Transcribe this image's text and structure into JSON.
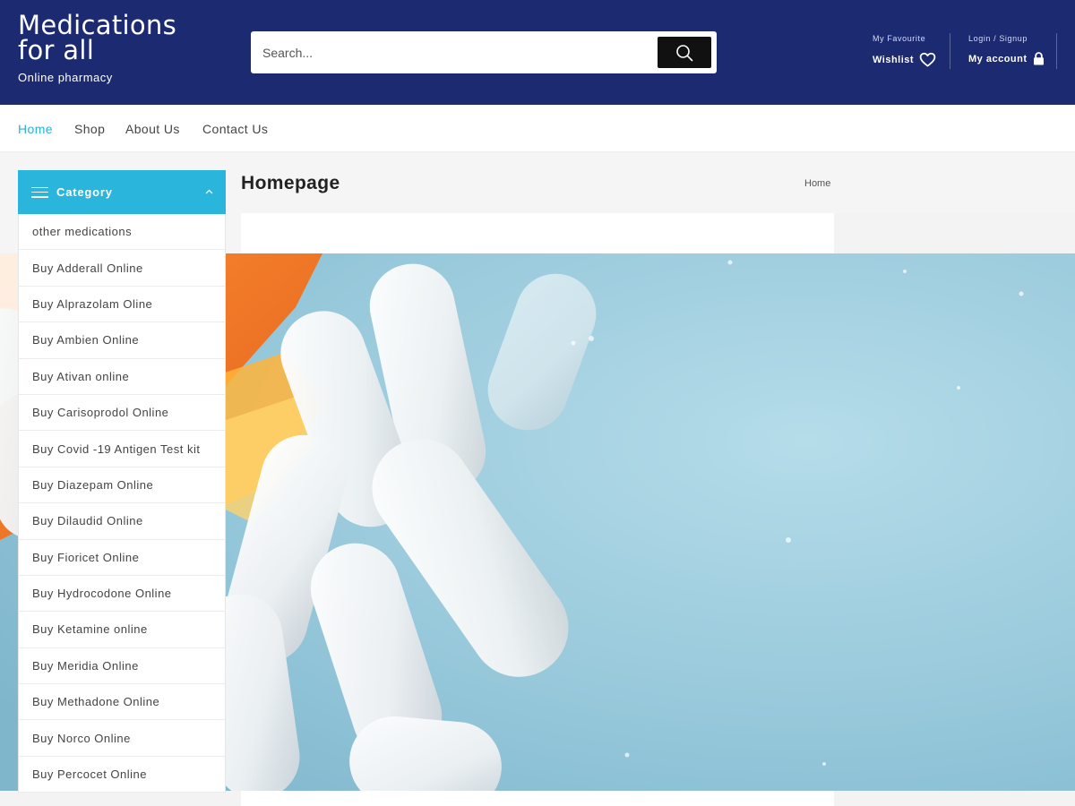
{
  "header": {
    "brand_title_line1": "Medications",
    "brand_title_line2": "for all",
    "brand_tagline": "Online pharmacy",
    "search_placeholder": "Search...",
    "wishlist_small": "My Favourite",
    "wishlist_label": "Wishlist",
    "account_small": "Login / Signup",
    "account_label": "My account"
  },
  "nav": {
    "items": [
      "Home",
      "Shop",
      "About Us",
      "Contact Us"
    ],
    "active": "Home"
  },
  "page": {
    "title": "Homepage",
    "breadcrumb": "Home"
  },
  "sidebar": {
    "title": "Category",
    "items": [
      "other medications",
      "Buy Adderall Online",
      "Buy Alprazolam Oline",
      "Buy Ambien Online",
      "Buy Ativan online",
      "Buy Carisoprodol Online",
      "Buy Covid -19 Antigen Test kit",
      "Buy Diazepam Online",
      "Buy Dilaudid Online",
      "Buy Fioricet Online",
      "Buy Hydrocodone Online",
      "Buy Ketamine online",
      "Buy Meridia Online",
      "Buy Methadone Online",
      "Buy Norco Online",
      "Buy Percocet Online"
    ]
  },
  "colors": {
    "header_bg": "#1c2a72",
    "accent": "#2ab5dc",
    "search_button": "#111111"
  },
  "icons": {
    "search_button": "search-icon",
    "wishlist": "heart-icon",
    "account": "lock-icon",
    "category_menu": "hamburger-icon",
    "category_toggle": "chevron-up-icon"
  }
}
